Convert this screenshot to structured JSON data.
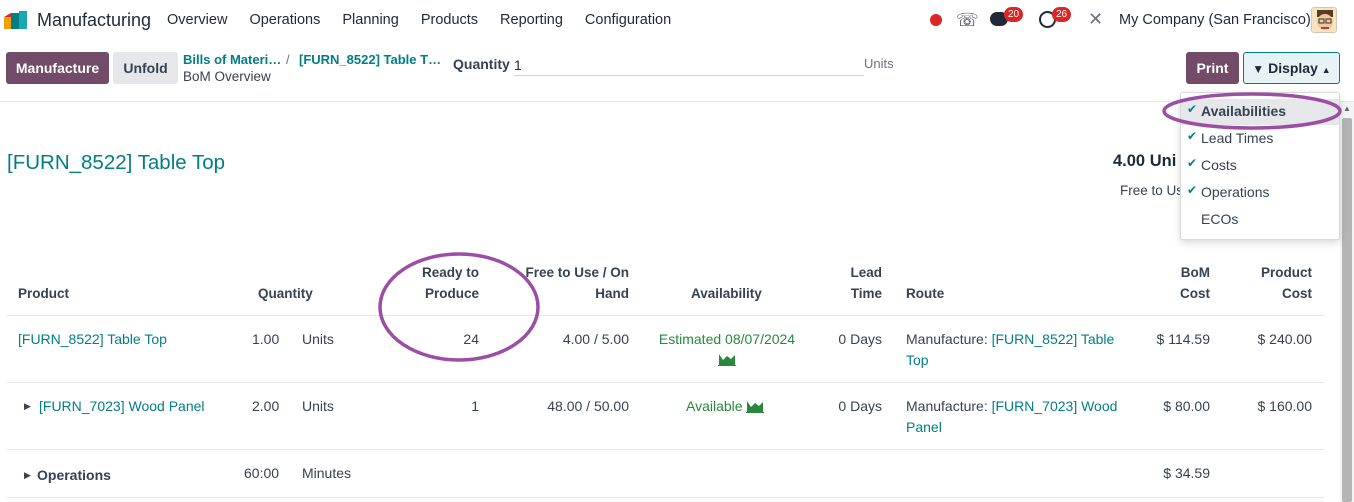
{
  "app": {
    "name": "Manufacturing",
    "menu": [
      "Overview",
      "Operations",
      "Planning",
      "Products",
      "Reporting",
      "Configuration"
    ],
    "chat_badge": "20",
    "activity_badge": "26",
    "company": "My Company (San Francisco)"
  },
  "control": {
    "manufacture_label": "Manufacture",
    "unfold_label": "Unfold",
    "breadcrumb": [
      "Bills of Materi…",
      "[FURN_8522] Table T…"
    ],
    "breadcrumb_separator": "/",
    "breadcrumb_current": "BoM Overview",
    "quantity_label": "Quantity",
    "quantity_value": "1",
    "quantity_unit": "Units",
    "print_label": "Print",
    "display_label": "Display"
  },
  "display_menu": [
    {
      "label": "Availabilities",
      "checked": true,
      "active": true
    },
    {
      "label": "Lead Times",
      "checked": true
    },
    {
      "label": "Costs",
      "checked": true
    },
    {
      "label": "Operations",
      "checked": true
    },
    {
      "label": "ECOs",
      "checked": false
    }
  ],
  "report": {
    "title": "[FURN_8522] Table Top",
    "units_summary": "4.00 Uni",
    "free_summary": "Free to Us",
    "headers": {
      "product": "Product",
      "quantity": "Quantity",
      "ready_1": "Ready to",
      "ready_2": "Produce",
      "free_1": "Free to Use / On",
      "free_2": "Hand",
      "availability": "Availability",
      "lead_1": "Lead",
      "lead_2": "Time",
      "route": "Route",
      "bom_1": "BoM",
      "bom_2": "Cost",
      "prod_1": "Product",
      "prod_2": "Cost"
    },
    "rows": [
      {
        "product": "[FURN_8522] Table Top",
        "quantity": "1.00",
        "uom": "Units",
        "ready": "24",
        "free": "4.00 / 5.00",
        "availability": "Estimated 08/07/2024",
        "lead": "0 Days",
        "route_prefix": "Manufacture:",
        "route_link_1": "[FURN_8522] Table",
        "route_link_2": "Top",
        "bom_cost": "$ 114.59",
        "product_cost": "$ 240.00"
      },
      {
        "product": "[FURN_7023] Wood Panel",
        "quantity": "2.00",
        "uom": "Units",
        "ready": "1",
        "free": "48.00 / 50.00",
        "availability": "Available",
        "lead": "0 Days",
        "route_prefix": "Manufacture:",
        "route_link_1": "[FURN_7023] Wood",
        "route_link_2": "Panel",
        "bom_cost": "$ 80.00",
        "product_cost": "$ 160.00"
      },
      {
        "product": "Operations",
        "quantity": "60:00",
        "uom": "Minutes",
        "bom_cost": "$ 34.59"
      }
    ]
  },
  "colors": {
    "brand": "#714b67",
    "link": "#017e84",
    "available": "#28893d",
    "annotation": "#9b4ea3",
    "badge": "#dc2626"
  }
}
